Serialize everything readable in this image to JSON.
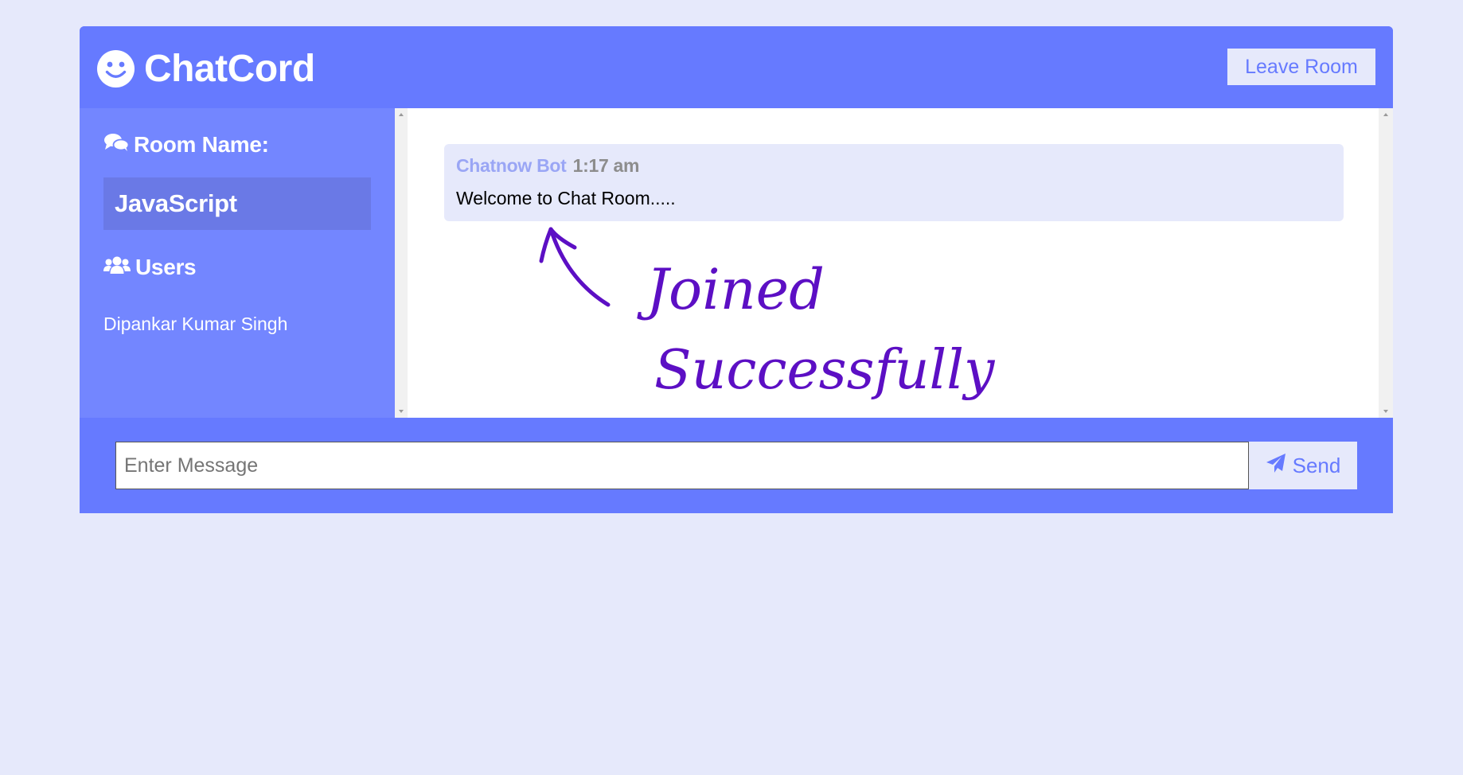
{
  "header": {
    "logo_icon": "smile-icon",
    "title": "ChatCord",
    "leave_label": "Leave Room"
  },
  "sidebar": {
    "room_heading_icon": "comments-icon",
    "room_heading": "Room Name:",
    "room_name": "JavaScript",
    "users_heading_icon": "users-icon",
    "users_heading": "Users",
    "users": [
      "Dipankar Kumar Singh"
    ]
  },
  "messages": [
    {
      "username": "Chatnow Bot",
      "time": "1:17 am",
      "text": "Welcome to Chat Room....."
    }
  ],
  "annotation": {
    "line1": "Joined",
    "line2": "Successfully",
    "color": "#5c0fc4"
  },
  "form": {
    "placeholder": "Enter Message",
    "send_icon": "paper-plane-icon",
    "send_label": "Send"
  },
  "colors": {
    "primary": "#667aff",
    "sidebar": "#7386ff",
    "light": "#e6e9fb",
    "room_box": "#6a79e6"
  }
}
